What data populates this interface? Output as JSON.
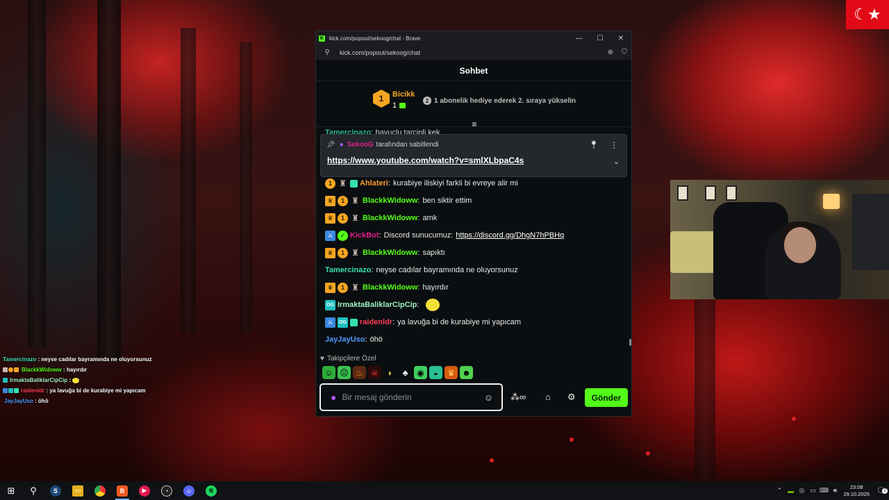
{
  "desktop": {
    "flag_symbol": "☾★"
  },
  "window": {
    "title": "kick.com/popout/sekoog/chat - Brave",
    "url": "kick.com/popout/sekoog/chat",
    "minimize_icon": "—",
    "maximize_icon": "☐",
    "close_icon": "✕"
  },
  "chat": {
    "header": "Sohbet",
    "goal": {
      "rank_badge": "1",
      "name": "Bicikk",
      "count": "1",
      "rank_icon": "2",
      "message": "1 abonelik hediye ederek 2. sıraya yükselin"
    },
    "truncated_message": {
      "username": "Tamercinazo",
      "text": "havuclu tarcinli kek"
    },
    "pinned": {
      "by_user": "SekooG",
      "by_text": "tarafından sabitlendi",
      "link": "https://www.youtube.com/watch?v=smlXLbpaC4s"
    },
    "messages": [
      {
        "username": "Ahlateri",
        "color": "#f59c2e",
        "text": "kurabiye iliskiyi farkli bi evreye alir mi",
        "badges": [
          "one",
          "figure",
          "gift"
        ]
      },
      {
        "username": "BlackkWidoww",
        "color": "#53fc18",
        "text": "ben siktir ettim",
        "badges": [
          "crown",
          "one",
          "figure"
        ]
      },
      {
        "username": "BlackkWidoww",
        "color": "#53fc18",
        "text": "amk",
        "badges": [
          "crown",
          "one",
          "figure"
        ]
      },
      {
        "username": "KickBot",
        "color": "#e0208a",
        "text": "Discord sunucumuz: ",
        "link": "https://discord.gg/DhgN7hPBHq",
        "badges": [
          "sword",
          "verify"
        ]
      },
      {
        "username": "BlackkWidoww",
        "color": "#53fc18",
        "text": "sapıktı",
        "badges": [
          "crown",
          "one",
          "figure"
        ]
      },
      {
        "username": "Tamercinazo",
        "color": "#35e0b0",
        "text": "neyse cadılar bayramında ne oluyorsunuz",
        "badges": []
      },
      {
        "username": "BlackkWidoww",
        "color": "#53fc18",
        "text": "hayırdır",
        "badges": [
          "crown",
          "one",
          "figure"
        ]
      },
      {
        "username": "IrmaktaBaliklarCipCip",
        "color": "#9cf0c0",
        "text": "",
        "badges": [
          "og"
        ],
        "emote": "moon"
      },
      {
        "username": "raidenldr",
        "color": "#ff3d5a",
        "text": "ya lavuğa bi de kurabiye mi yapıcam",
        "badges": [
          "sword",
          "og",
          "gift"
        ]
      },
      {
        "username": "JayJayUso",
        "color": "#4a9bff",
        "text": "öhö",
        "badges": []
      }
    ],
    "emote_section_label": "Takipçilere Özel",
    "input_placeholder": "Bir mesaj gönderin",
    "send_label": "Gönder"
  },
  "overlay": {
    "lines": [
      {
        "username": "Tamercinazo",
        "color": "#35e0b0",
        "text": "neyse cadılar bayramında ne oluyorsunuz"
      },
      {
        "username": "BlackkWidoww",
        "color": "#53fc18",
        "text": "hayırdır"
      },
      {
        "username": "IrmaktaBaliklarCipCip",
        "color": "#9cf0c0",
        "text": ""
      },
      {
        "username": "raidenldr",
        "color": "#ff3d5a",
        "text": "ya lavuğa bi de kurabiye mi yapıcam"
      },
      {
        "username": "JayJayUso",
        "color": "#4a9bff",
        "text": "öhö"
      }
    ]
  },
  "taskbar": {
    "time": "23:08",
    "date": "29.10.2025",
    "notification_count": "2"
  },
  "colors": {
    "kick_green": "#53fc18",
    "gold": "#f5a623",
    "background": "#0b0e10"
  }
}
